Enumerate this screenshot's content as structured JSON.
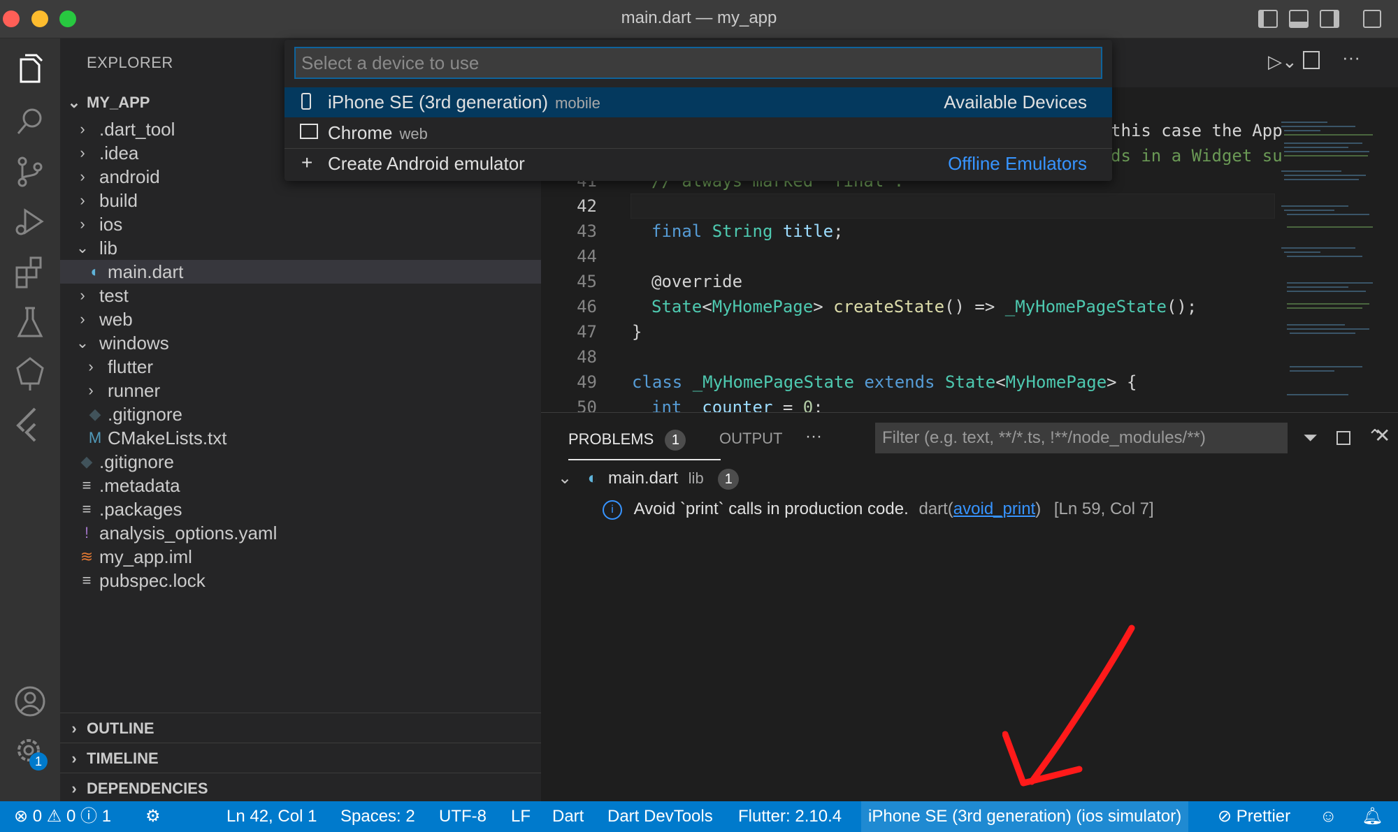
{
  "window": {
    "title": "main.dart — my_app"
  },
  "sidebar": {
    "title": "EXPLORER",
    "root": "MY_APP",
    "tree": [
      {
        "label": ".dart_tool",
        "kind": "folder",
        "expanded": false
      },
      {
        "label": ".idea",
        "kind": "folder",
        "expanded": false
      },
      {
        "label": "android",
        "kind": "folder",
        "expanded": false
      },
      {
        "label": "build",
        "kind": "folder",
        "expanded": false
      },
      {
        "label": "ios",
        "kind": "folder",
        "expanded": false
      },
      {
        "label": "lib",
        "kind": "folder",
        "expanded": true
      },
      {
        "label": "main.dart",
        "kind": "dart",
        "selected": true
      },
      {
        "label": "test",
        "kind": "folder",
        "expanded": false
      },
      {
        "label": "web",
        "kind": "folder",
        "expanded": false
      },
      {
        "label": "windows",
        "kind": "folder",
        "expanded": true
      },
      {
        "label": "flutter",
        "kind": "folder",
        "expanded": false
      },
      {
        "label": "runner",
        "kind": "folder",
        "expanded": false
      },
      {
        "label": ".gitignore",
        "kind": "git"
      },
      {
        "label": "CMakeLists.txt",
        "kind": "cmake"
      },
      {
        "label": ".gitignore",
        "kind": "git"
      },
      {
        "label": ".metadata",
        "kind": "text"
      },
      {
        "label": ".packages",
        "kind": "text"
      },
      {
        "label": "analysis_options.yaml",
        "kind": "yaml"
      },
      {
        "label": "my_app.iml",
        "kind": "rss"
      },
      {
        "label": "pubspec.lock",
        "kind": "text"
      }
    ],
    "sections": [
      "OUTLINE",
      "TIMELINE",
      "DEPENDENCIES"
    ]
  },
  "quickpick": {
    "placeholder": "Select a device to use",
    "items": [
      {
        "label": "iPhone SE (3rd generation)",
        "desc": "mobile",
        "group": "Available Devices"
      },
      {
        "label": "Chrome",
        "desc": "web",
        "group": ""
      },
      {
        "label": "Create Android emulator",
        "desc": "",
        "group": "Offline Emulators"
      }
    ]
  },
  "editor": {
    "partial_top": [
      "this case the App",
      "ds in a Widget su"
    ],
    "line_numbers": [
      "41",
      "42",
      "43",
      "44",
      "45",
      "46",
      "47",
      "48",
      "49",
      "50"
    ],
    "lines": {
      "l41": "// always marked \"final\".",
      "l43_kw": "final",
      "l43_ty": "String",
      "l43_vr": "title",
      "l45": "@override",
      "l46_ty1": "State",
      "l46_ty2": "MyHomePage",
      "l46_fn": "createState",
      "l46_ty3": "_MyHomePageState",
      "l47": "}",
      "l49_kw": "class",
      "l49_ty": "_MyHomePageState",
      "l49_kw2": "extends",
      "l49_ty2": "State",
      "l49_ty3": "MyHomePage",
      "l50_kw": "int",
      "l50_vr": "_counter",
      "l50_nm": "0"
    }
  },
  "panel": {
    "tabs": [
      {
        "label": "PROBLEMS",
        "count": "1"
      },
      {
        "label": "OUTPUT"
      }
    ],
    "more": "···",
    "filter_placeholder": "Filter (e.g. text, **/*.ts, !**/node_modules/**)",
    "file": {
      "name": "main.dart",
      "folder": "lib",
      "count": "1"
    },
    "problem": {
      "message": "Avoid `print` calls in production code.",
      "source": "dart",
      "code": "avoid_print",
      "location": "[Ln 59, Col 7]"
    }
  },
  "statusbar": {
    "errors": "0",
    "warnings": "0",
    "infos": "1",
    "position": "Ln 42, Col 1",
    "spaces": "Spaces: 2",
    "encoding": "UTF-8",
    "eol": "LF",
    "language": "Dart",
    "devtools": "Dart DevTools",
    "flutter": "Flutter: 2.10.4",
    "device": "iPhone SE (3rd generation) (ios simulator)",
    "prettier": "Prettier"
  },
  "activity": {
    "settings_badge": "1"
  },
  "colors": {
    "accent": "#007acc",
    "selection": "#04395e",
    "arrow": "#ff1a1a"
  }
}
